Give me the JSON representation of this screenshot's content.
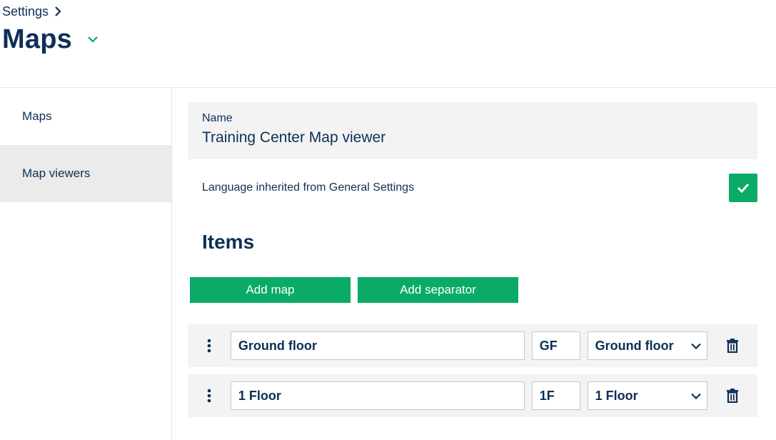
{
  "breadcrumb": {
    "label": "Settings",
    "icon": "chevron-right-icon"
  },
  "page": {
    "title": "Maps",
    "caret_icon": "chevron-down-icon"
  },
  "sidebar": {
    "items": [
      {
        "label": "Maps",
        "active": false
      },
      {
        "label": "Map viewers",
        "active": true
      }
    ]
  },
  "form": {
    "name_label": "Name",
    "name_value": "Training Center Map viewer",
    "language_label": "Language inherited from General Settings",
    "language_checked": true
  },
  "items_section": {
    "heading": "Items",
    "add_map_label": "Add map",
    "add_separator_label": "Add separator",
    "rows": [
      {
        "name": "Ground floor",
        "short": "GF",
        "map": "Ground floor"
      },
      {
        "name": "1 Floor",
        "short": "1F",
        "map": "1 Floor"
      }
    ]
  },
  "colors": {
    "accent": "#0aab67",
    "text": "#0e2f56",
    "panel": "#f3f3f3",
    "active_nav": "#ebebeb"
  }
}
